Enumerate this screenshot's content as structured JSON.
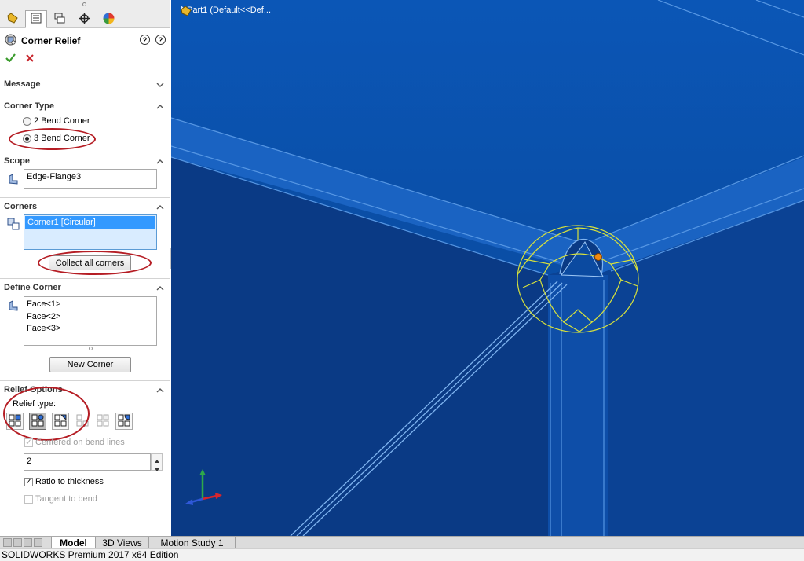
{
  "panel": {
    "title": "Corner Relief",
    "tabs": [
      "feature-manager",
      "property-manager",
      "configuration-manager",
      "dimxpert-manager",
      "display-manager"
    ]
  },
  "sections": {
    "message": "Message",
    "corner_type": {
      "title": "Corner Type",
      "options": [
        "2 Bend Corner",
        "3 Bend Corner"
      ],
      "selected": "3 Bend Corner"
    },
    "scope": {
      "title": "Scope",
      "value": "Edge-Flange3"
    },
    "corners": {
      "title": "Corners",
      "items": [
        "Corner1 [Circular]"
      ],
      "collect_button": "Collect all corners"
    },
    "define_corner": {
      "title": "Define Corner",
      "faces": [
        "Face<1>",
        "Face<2>",
        "Face<3>"
      ],
      "new_button": "New Corner"
    },
    "relief_options": {
      "title": "Relief Options",
      "relief_type_label": "Relief type:",
      "relief_types": [
        "rectangular",
        "circular",
        "tear",
        "constant-width",
        "full-round"
      ],
      "selected_type": "circular",
      "centered_label": "Centered on bend lines",
      "centered_checked": true,
      "centered_enabled": false,
      "value": "2",
      "ratio_label": "Ratio to thickness",
      "ratio_checked": true,
      "tangent_label": "Tangent to bend",
      "tangent_checked": false,
      "tangent_enabled": false
    }
  },
  "viewport": {
    "tree_item": "Part1  (Default<<Def...",
    "background": "#0a4ea6"
  },
  "bottom_tabs": [
    "Model",
    "3D Views",
    "Motion Study 1"
  ],
  "active_tab": "Model",
  "status_text": "SOLIDWORKS Premium 2017 x64 Edition",
  "colors": {
    "annotation": "#b51d24",
    "highlight_outline": "#d8e23c",
    "selection_blue": "#3399ff"
  }
}
